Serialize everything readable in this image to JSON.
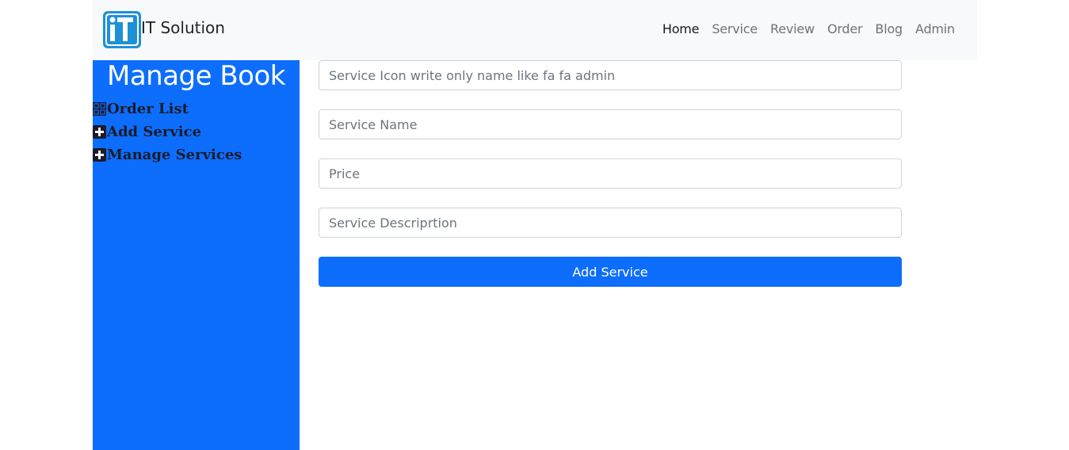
{
  "navbar": {
    "brand_text": "IT Solution",
    "logo_letters": "iT",
    "links": [
      "Home",
      "Service",
      "Review",
      "Order",
      "Blog",
      "Admin"
    ]
  },
  "sidebar": {
    "title": "Manage Book",
    "items": [
      {
        "label": "Order List",
        "icon": "grid-icon"
      },
      {
        "label": "Add Service",
        "icon": "plus-square-icon"
      },
      {
        "label": "Manage Services",
        "icon": "plus-square-icon"
      }
    ]
  },
  "form": {
    "icon_placeholder": "Service Icon write only name like fa fa admin",
    "name_placeholder": "Service Name",
    "price_placeholder": "Price",
    "description_placeholder": "Service Descriprtion",
    "submit_label": "Add Service"
  },
  "colors": {
    "primary": "#0d6efd",
    "navbar_bg": "#f8f9fa",
    "logo_blue": "#1e90d6"
  }
}
